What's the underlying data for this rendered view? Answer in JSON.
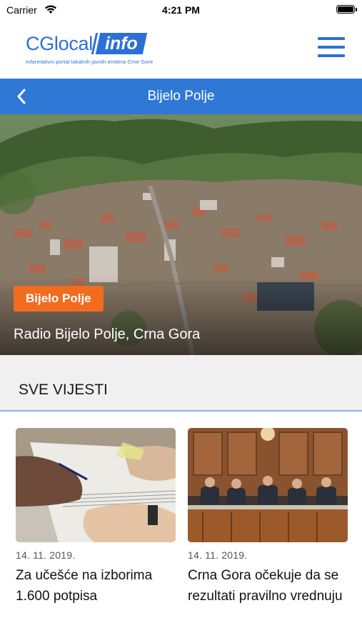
{
  "status_bar": {
    "carrier": "Carrier",
    "time": "4:21 PM",
    "battery_level": 1.0
  },
  "header": {
    "logo_text": "CGlocal",
    "logo_badge": "info",
    "logo_subtitle": "Informativni portal lokalnih javnih emitera Crne Gore",
    "menu_icon": "hamburger-menu-icon"
  },
  "nav": {
    "back_icon": "chevron-left-icon",
    "title": "Bijelo Polje"
  },
  "hero": {
    "badge": "Bijelo Polje",
    "caption": "Radio Bijelo Polje, Crna Gora"
  },
  "section": {
    "title": "SVE VIJESTI"
  },
  "news": [
    {
      "date": "14. 11. 2019.",
      "title": "Za učešće na izborima 1.600 potpisa"
    },
    {
      "date": "14. 11. 2019.",
      "title": "Crna Gora očekuje da se rezultati pravilno vrednuju"
    }
  ],
  "colors": {
    "brand_blue": "#2e6fd6",
    "nav_blue": "#2f78d6",
    "badge_orange": "#f26c1f"
  }
}
